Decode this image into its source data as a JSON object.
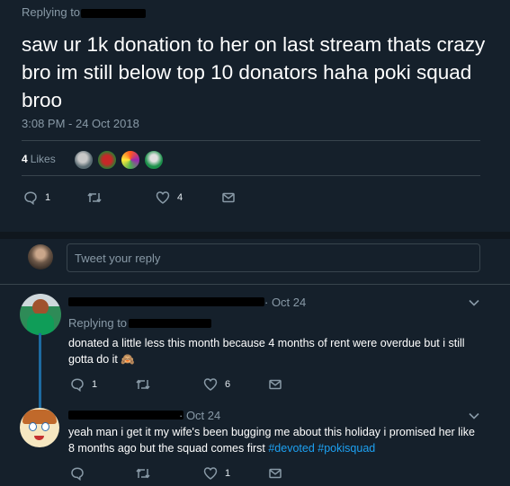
{
  "tweet": {
    "replying_to_label": "Replying to",
    "text": "saw ur 1k donation to her on last stream thats crazy bro im still below top 10 donators haha poki squad broo",
    "timestamp": "3:08 PM - 24 Oct 2018",
    "likes_count": "4",
    "likes_label": "Likes",
    "actions": {
      "reply_count": "1",
      "retweet_count": "",
      "like_count": "4"
    }
  },
  "composer": {
    "placeholder": "Tweet your reply"
  },
  "replies": [
    {
      "date": "· Oct 24",
      "replying_to_label": "Replying to",
      "text": "donated a little less this month because 4 months of rent were overdue but i still gotta do it",
      "emoji": "🙈",
      "actions": {
        "reply_count": "1",
        "retweet_count": "",
        "like_count": "6"
      }
    },
    {
      "date": "· Oct 24",
      "text_before": "yeah man i get it my wife's been bugging me about this holiday i promised her like 8 months ago but the squad comes first ",
      "hashtag_1": "#devoted",
      "hashtag_2": "#pokisquad",
      "actions": {
        "reply_count": "",
        "retweet_count": "",
        "like_count": "1"
      }
    }
  ],
  "icons": {
    "reply": "reply-icon",
    "retweet": "retweet-icon",
    "like": "heart-icon",
    "dm": "envelope-icon",
    "more": "chevron-down-icon"
  },
  "colors": {
    "background": "#15202b",
    "text_muted": "#8899a6",
    "accent": "#1da1f2",
    "thread": "#1d6aa0"
  }
}
